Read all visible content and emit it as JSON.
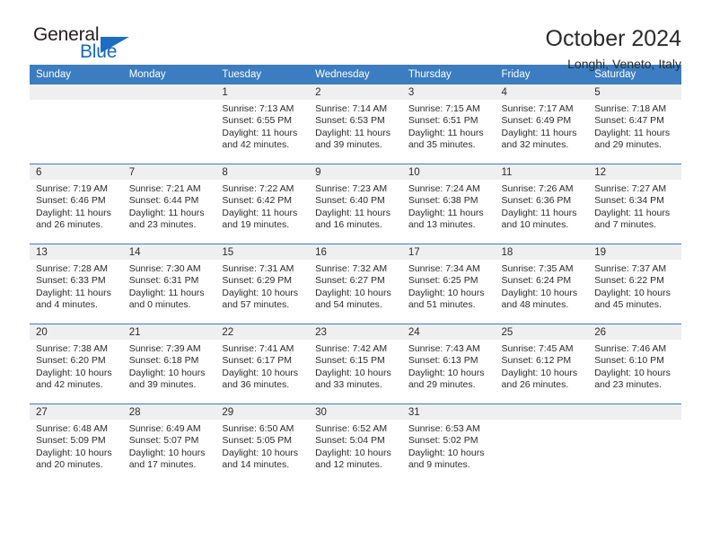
{
  "brand": {
    "name_top": "General",
    "name_bottom": "Blue",
    "accent_color": "#1b6ec2"
  },
  "header": {
    "title": "October 2024",
    "subtitle": "Longhi, Veneto, Italy"
  },
  "theme": {
    "header_bg": "#3b7dc0",
    "daynum_bg": "#efefef",
    "text": "#2b2b2b",
    "rule": "#3b7dc0"
  },
  "labels": {
    "sunrise_prefix": "Sunrise:",
    "sunset_prefix": "Sunset:",
    "daylight_prefix": "Daylight:"
  },
  "weekdays": [
    "Sunday",
    "Monday",
    "Tuesday",
    "Wednesday",
    "Thursday",
    "Friday",
    "Saturday"
  ],
  "weeks": [
    [
      {
        "day": "",
        "empty": true
      },
      {
        "day": "",
        "empty": true
      },
      {
        "day": "1",
        "sunrise": "Sunrise: 7:13 AM",
        "sunset": "Sunset: 6:55 PM",
        "daylight": "Daylight: 11 hours and 42 minutes."
      },
      {
        "day": "2",
        "sunrise": "Sunrise: 7:14 AM",
        "sunset": "Sunset: 6:53 PM",
        "daylight": "Daylight: 11 hours and 39 minutes."
      },
      {
        "day": "3",
        "sunrise": "Sunrise: 7:15 AM",
        "sunset": "Sunset: 6:51 PM",
        "daylight": "Daylight: 11 hours and 35 minutes."
      },
      {
        "day": "4",
        "sunrise": "Sunrise: 7:17 AM",
        "sunset": "Sunset: 6:49 PM",
        "daylight": "Daylight: 11 hours and 32 minutes."
      },
      {
        "day": "5",
        "sunrise": "Sunrise: 7:18 AM",
        "sunset": "Sunset: 6:47 PM",
        "daylight": "Daylight: 11 hours and 29 minutes."
      }
    ],
    [
      {
        "day": "6",
        "sunrise": "Sunrise: 7:19 AM",
        "sunset": "Sunset: 6:46 PM",
        "daylight": "Daylight: 11 hours and 26 minutes."
      },
      {
        "day": "7",
        "sunrise": "Sunrise: 7:21 AM",
        "sunset": "Sunset: 6:44 PM",
        "daylight": "Daylight: 11 hours and 23 minutes."
      },
      {
        "day": "8",
        "sunrise": "Sunrise: 7:22 AM",
        "sunset": "Sunset: 6:42 PM",
        "daylight": "Daylight: 11 hours and 19 minutes."
      },
      {
        "day": "9",
        "sunrise": "Sunrise: 7:23 AM",
        "sunset": "Sunset: 6:40 PM",
        "daylight": "Daylight: 11 hours and 16 minutes."
      },
      {
        "day": "10",
        "sunrise": "Sunrise: 7:24 AM",
        "sunset": "Sunset: 6:38 PM",
        "daylight": "Daylight: 11 hours and 13 minutes."
      },
      {
        "day": "11",
        "sunrise": "Sunrise: 7:26 AM",
        "sunset": "Sunset: 6:36 PM",
        "daylight": "Daylight: 11 hours and 10 minutes."
      },
      {
        "day": "12",
        "sunrise": "Sunrise: 7:27 AM",
        "sunset": "Sunset: 6:34 PM",
        "daylight": "Daylight: 11 hours and 7 minutes."
      }
    ],
    [
      {
        "day": "13",
        "sunrise": "Sunrise: 7:28 AM",
        "sunset": "Sunset: 6:33 PM",
        "daylight": "Daylight: 11 hours and 4 minutes."
      },
      {
        "day": "14",
        "sunrise": "Sunrise: 7:30 AM",
        "sunset": "Sunset: 6:31 PM",
        "daylight": "Daylight: 11 hours and 0 minutes."
      },
      {
        "day": "15",
        "sunrise": "Sunrise: 7:31 AM",
        "sunset": "Sunset: 6:29 PM",
        "daylight": "Daylight: 10 hours and 57 minutes."
      },
      {
        "day": "16",
        "sunrise": "Sunrise: 7:32 AM",
        "sunset": "Sunset: 6:27 PM",
        "daylight": "Daylight: 10 hours and 54 minutes."
      },
      {
        "day": "17",
        "sunrise": "Sunrise: 7:34 AM",
        "sunset": "Sunset: 6:25 PM",
        "daylight": "Daylight: 10 hours and 51 minutes."
      },
      {
        "day": "18",
        "sunrise": "Sunrise: 7:35 AM",
        "sunset": "Sunset: 6:24 PM",
        "daylight": "Daylight: 10 hours and 48 minutes."
      },
      {
        "day": "19",
        "sunrise": "Sunrise: 7:37 AM",
        "sunset": "Sunset: 6:22 PM",
        "daylight": "Daylight: 10 hours and 45 minutes."
      }
    ],
    [
      {
        "day": "20",
        "sunrise": "Sunrise: 7:38 AM",
        "sunset": "Sunset: 6:20 PM",
        "daylight": "Daylight: 10 hours and 42 minutes."
      },
      {
        "day": "21",
        "sunrise": "Sunrise: 7:39 AM",
        "sunset": "Sunset: 6:18 PM",
        "daylight": "Daylight: 10 hours and 39 minutes."
      },
      {
        "day": "22",
        "sunrise": "Sunrise: 7:41 AM",
        "sunset": "Sunset: 6:17 PM",
        "daylight": "Daylight: 10 hours and 36 minutes."
      },
      {
        "day": "23",
        "sunrise": "Sunrise: 7:42 AM",
        "sunset": "Sunset: 6:15 PM",
        "daylight": "Daylight: 10 hours and 33 minutes."
      },
      {
        "day": "24",
        "sunrise": "Sunrise: 7:43 AM",
        "sunset": "Sunset: 6:13 PM",
        "daylight": "Daylight: 10 hours and 29 minutes."
      },
      {
        "day": "25",
        "sunrise": "Sunrise: 7:45 AM",
        "sunset": "Sunset: 6:12 PM",
        "daylight": "Daylight: 10 hours and 26 minutes."
      },
      {
        "day": "26",
        "sunrise": "Sunrise: 7:46 AM",
        "sunset": "Sunset: 6:10 PM",
        "daylight": "Daylight: 10 hours and 23 minutes."
      }
    ],
    [
      {
        "day": "27",
        "sunrise": "Sunrise: 6:48 AM",
        "sunset": "Sunset: 5:09 PM",
        "daylight": "Daylight: 10 hours and 20 minutes."
      },
      {
        "day": "28",
        "sunrise": "Sunrise: 6:49 AM",
        "sunset": "Sunset: 5:07 PM",
        "daylight": "Daylight: 10 hours and 17 minutes."
      },
      {
        "day": "29",
        "sunrise": "Sunrise: 6:50 AM",
        "sunset": "Sunset: 5:05 PM",
        "daylight": "Daylight: 10 hours and 14 minutes."
      },
      {
        "day": "30",
        "sunrise": "Sunrise: 6:52 AM",
        "sunset": "Sunset: 5:04 PM",
        "daylight": "Daylight: 10 hours and 12 minutes."
      },
      {
        "day": "31",
        "sunrise": "Sunrise: 6:53 AM",
        "sunset": "Sunset: 5:02 PM",
        "daylight": "Daylight: 10 hours and 9 minutes."
      },
      {
        "day": "",
        "empty": true
      },
      {
        "day": "",
        "empty": true
      }
    ]
  ]
}
